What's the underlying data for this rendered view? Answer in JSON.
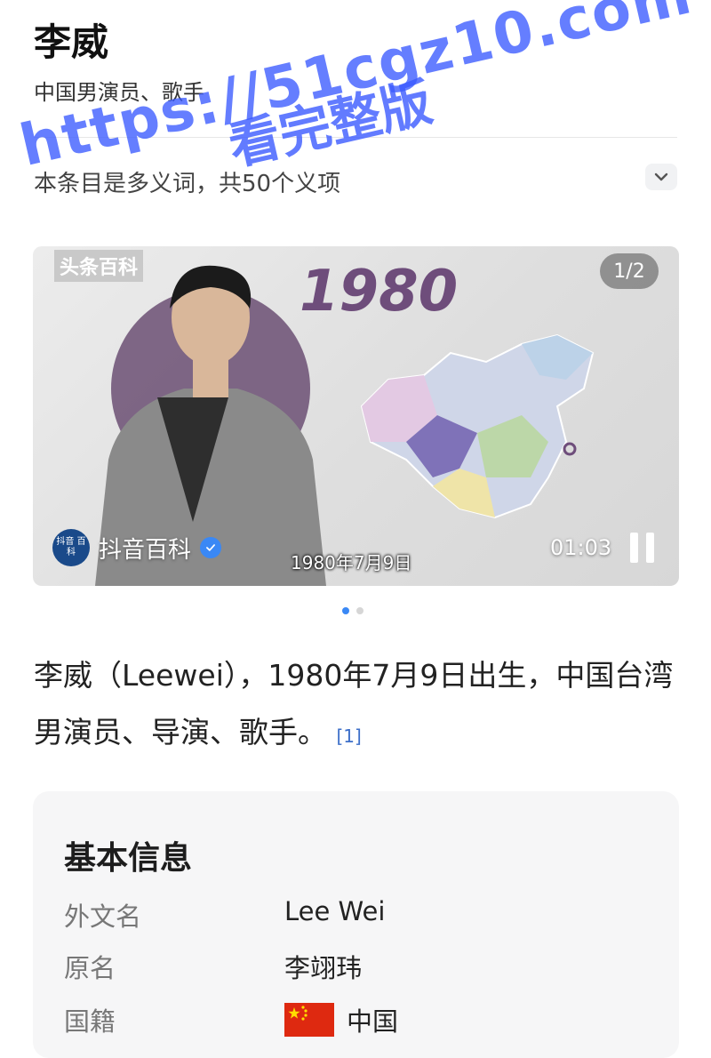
{
  "header": {
    "title": "李威",
    "subtitle": "中国男演员、歌手",
    "ambiguity_notice": "本条目是多义词，共50个义项"
  },
  "watermark": {
    "line1": "https://51cgz10.com",
    "line2": "看完整版"
  },
  "video": {
    "brand": "头条百科",
    "year_text": "1980",
    "page_counter": "1/2",
    "source_badge": "抖音 百科",
    "source_name": "抖音百科",
    "date_caption": "1980年7月9日",
    "time": "01:03",
    "carousel_index": 1,
    "carousel_total": 2
  },
  "summary": {
    "text": "李威（Leewei），1980年7月9日出生，中国台湾男演员、导演、歌手。",
    "citation": "[1]"
  },
  "info_card": {
    "title": "基本信息",
    "rows": [
      {
        "key": "外文名",
        "value": "Lee Wei"
      },
      {
        "key": "原名",
        "value": "李翊玮"
      },
      {
        "key": "国籍",
        "value": "中国",
        "flag_icon": "china-flag-icon"
      }
    ]
  },
  "colors": {
    "accent": "#3a88f5",
    "year_purple": "#6e4d7b",
    "watermark": "#3b5bff",
    "card_bg": "#f6f6f7"
  }
}
